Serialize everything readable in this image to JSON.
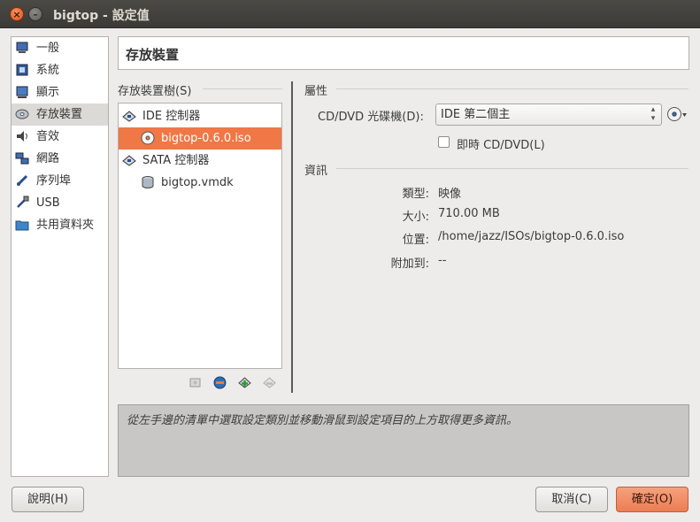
{
  "window": {
    "title": "bigtop - 設定值",
    "close_glyph": "×",
    "min_glyph": "–"
  },
  "nav": {
    "items": [
      {
        "label": "一般",
        "icon": "general-icon"
      },
      {
        "label": "系統",
        "icon": "system-icon"
      },
      {
        "label": "顯示",
        "icon": "display-icon"
      },
      {
        "label": "存放裝置",
        "icon": "storage-icon",
        "selected": true
      },
      {
        "label": "音效",
        "icon": "audio-icon"
      },
      {
        "label": "網路",
        "icon": "network-icon"
      },
      {
        "label": "序列埠",
        "icon": "serial-port-icon"
      },
      {
        "label": "USB",
        "icon": "usb-icon"
      },
      {
        "label": "共用資料夾",
        "icon": "shared-folder-icon"
      }
    ]
  },
  "header": {
    "title": "存放裝置"
  },
  "storage_tree": {
    "label": "存放裝置樹(S)",
    "items": [
      {
        "label": "IDE 控制器",
        "type": "controller",
        "icon": "ide-controller-icon"
      },
      {
        "label": "bigtop-0.6.0.iso",
        "type": "attachment",
        "icon": "optical-disc-icon",
        "selected": true
      },
      {
        "label": "SATA 控制器",
        "type": "controller",
        "icon": "sata-controller-icon"
      },
      {
        "label": "bigtop.vmdk",
        "type": "attachment",
        "icon": "hard-disk-icon"
      }
    ]
  },
  "attributes": {
    "label": "屬性",
    "drive_label": "CD/DVD 光碟機(D):",
    "drive_value": "IDE 第二個主",
    "live_cd_label": "即時 CD/DVD(L)",
    "live_cd_checked": false
  },
  "info": {
    "label": "資訊",
    "rows": [
      {
        "key": "類型:",
        "value": "映像"
      },
      {
        "key": "大小:",
        "value": "710.00 MB"
      },
      {
        "key": "位置:",
        "value": "/home/jazz/ISOs/bigtop-0.6.0.iso"
      },
      {
        "key": "附加到:",
        "value": "--"
      }
    ]
  },
  "hint": {
    "text": "從左手邊的清單中選取設定類別並移動滑鼠到設定項目的上方取得更多資訊。"
  },
  "buttons": {
    "help": "說明(H)",
    "cancel": "取消(C)",
    "ok": "確定(O)"
  },
  "colors": {
    "accent": "#f07746",
    "titlebar": "#3c3b37"
  }
}
